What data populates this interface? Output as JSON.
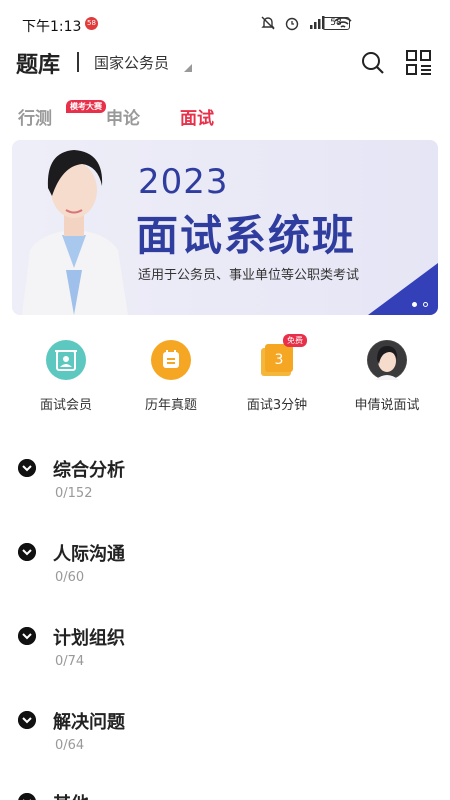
{
  "status_bar": {
    "time": "下午1:13",
    "notification_badge": "58",
    "battery": "58",
    "network_label": "HD"
  },
  "header": {
    "title": "题库",
    "exam_type": "国家公务员",
    "search_icon": "search-icon",
    "menu_icon": "grid-list-icon"
  },
  "tabs": [
    {
      "label": "行测",
      "badge": "模考大赛",
      "active": false
    },
    {
      "label": "申论",
      "active": false
    },
    {
      "label": "面试",
      "active": true
    }
  ],
  "banner": {
    "year": "2023",
    "headline": "面试系统班",
    "subtitle": "适用于公务员、事业单位等公职类考试",
    "accent_color": "#2f3d9e",
    "page_indicator": {
      "current": 1,
      "total": 2
    }
  },
  "quick_actions": [
    {
      "label": "面试会员",
      "icon": "member-card-icon",
      "color": "#5cc8c0"
    },
    {
      "label": "历年真题",
      "icon": "calendar-icon",
      "color": "#f5a623"
    },
    {
      "label": "面试3分钟",
      "icon": "book-3-icon",
      "color": "#f5a623",
      "badge": "免费",
      "badge_num": "3"
    },
    {
      "label": "申倩说面试",
      "icon": "avatar-icon",
      "color": "#555555"
    }
  ],
  "categories": [
    {
      "name": "综合分析",
      "count": "0/152"
    },
    {
      "name": "人际沟通",
      "count": "0/60"
    },
    {
      "name": "计划组织",
      "count": "0/74"
    },
    {
      "name": "解决问题",
      "count": "0/64"
    },
    {
      "name": "其他",
      "count": ""
    }
  ],
  "colors": {
    "accent": "#e8304a",
    "inactive_tab": "#999999"
  }
}
